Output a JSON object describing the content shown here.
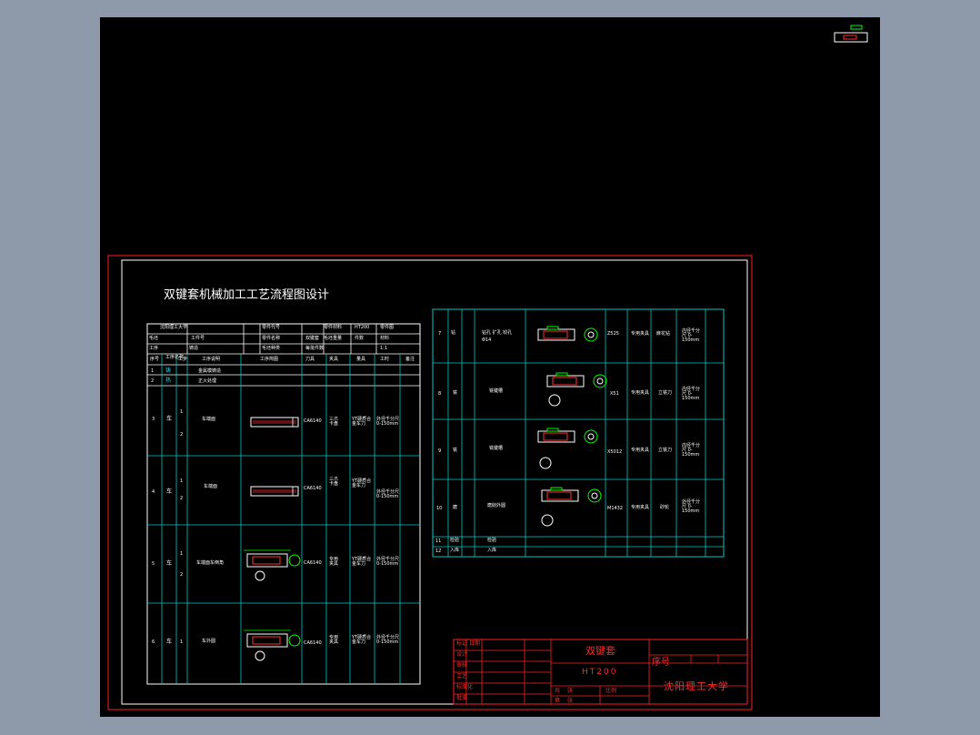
{
  "colors": {
    "paper": "#000000",
    "backdrop": "#8e9aaa",
    "frame": "#ff2020",
    "inner_border": "#ffffff",
    "grid": "#00c8c8",
    "part": "#ffffff",
    "part_accent": "#00ff00",
    "part_hatch": "#ff3030",
    "dim": "#00ff00"
  },
  "drawing_title": "双键套机械加工工艺流程图设计",
  "left_table": {
    "header_rows": [
      [
        "沈阳理工大学",
        "",
        "零件代号",
        "",
        "零件材料",
        "HT200",
        "零件图"
      ],
      [
        "毛坯",
        "",
        "工件号",
        "",
        "零件名称",
        "双键套",
        "毛坯重量",
        "件数",
        "材料"
      ],
      [
        "工序",
        "",
        "毛坯种类",
        "铸造",
        "每批件数",
        "",
        "1:1"
      ]
    ],
    "column_headers": [
      "序号",
      "工序名称",
      "工步",
      "工序说明",
      "工序简图",
      "刀具",
      "夹具",
      "量具",
      "工时",
      "备注"
    ],
    "rows": [
      {
        "no": "1",
        "op": "铸",
        "step": "",
        "desc": "金属模铸造"
      },
      {
        "no": "2",
        "op": "热",
        "step": "",
        "desc": "正火处理"
      },
      {
        "no": "3",
        "op": "车",
        "steps": [
          "1",
          "2"
        ],
        "desc": "车端面",
        "tool": "CA6140",
        "fixture": "三爪卡盘",
        "measure": "YT硬质合金车刀",
        "time": "外径千分尺 0-150mm"
      },
      {
        "no": "4",
        "op": "车",
        "steps": [
          "1",
          "2"
        ],
        "desc": "车端面",
        "tool": "CA6140",
        "fixture": "三爪卡盘",
        "measure": "YT硬质合金车刀",
        "time": "外径千分尺 0-150mm"
      },
      {
        "no": "5",
        "op": "车",
        "steps": [
          "1",
          "2"
        ],
        "desc": "车端面车倒角",
        "tool": "CA6140",
        "fixture": "专用夹具",
        "measure": "YT硬质合金车刀",
        "time": "外径千分尺 0-150mm"
      },
      {
        "no": "6",
        "op": "车",
        "steps": [
          "1"
        ],
        "desc": "车外圆",
        "tool": "CA6140",
        "fixture": "专用夹具",
        "measure": "YT硬质合金车刀",
        "time": "外径千分尺 0-150mm"
      }
    ]
  },
  "right_table": {
    "rows": [
      {
        "no": "7",
        "op": "钻",
        "desc": "钻孔 扩孔 铰孔",
        "sub": "Φ14",
        "tool": "Z525",
        "fixture": "专用夹具",
        "measure": "麻花钻",
        "time": "内径千分尺 0-150mm"
      },
      {
        "no": "8",
        "op": "铣",
        "desc": "铣键槽",
        "tool": "X51",
        "fixture": "专用夹具",
        "measure": "立铣刀",
        "time": "内径千分尺 0-150mm"
      },
      {
        "no": "9",
        "op": "铣",
        "desc": "铣键槽",
        "tool": "X5012",
        "fixture": "专用夹具",
        "measure": "立铣刀",
        "time": "内径千分尺 0-150mm"
      },
      {
        "no": "10",
        "op": "磨",
        "desc": "磨削外圆",
        "tool": "M1432",
        "fixture": "专用夹具",
        "measure": "砂轮",
        "time": "外径千分尺 0-150mm"
      },
      {
        "no": "11",
        "op": "检验",
        "desc": "检验"
      },
      {
        "no": "12",
        "op": "入库",
        "desc": "入库"
      }
    ]
  },
  "title_block": {
    "part_name": "双键套",
    "material": "HT200",
    "sequence_label": "序号",
    "school": "沈阳理工大学",
    "left_labels": [
      "标记",
      "设计",
      "审核",
      "工艺",
      "标准化",
      "批准",
      "日期"
    ],
    "bottom_labels": [
      "共",
      "张",
      "第",
      "张",
      "比例"
    ]
  }
}
